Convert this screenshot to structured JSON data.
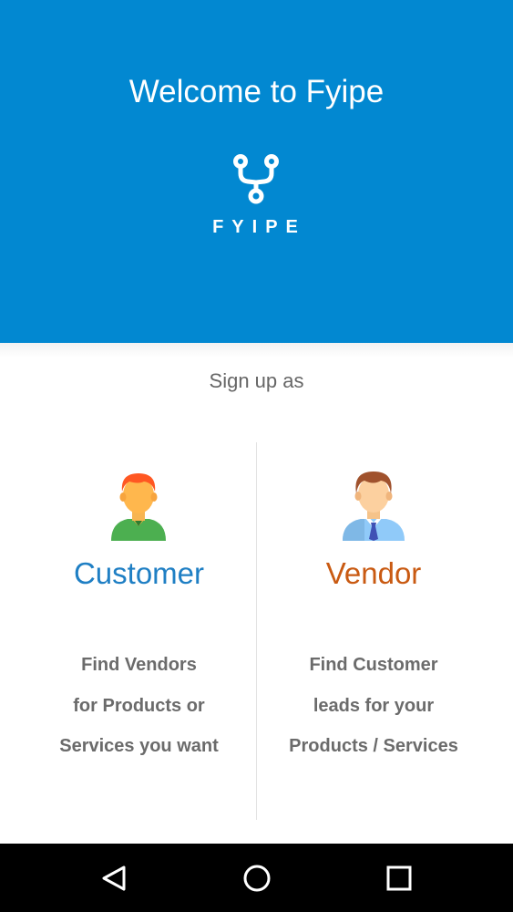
{
  "header": {
    "welcome_title": "Welcome to Fyipe",
    "logo_text": "FYIPE",
    "logo_icon": "fyipe-fork-logo-icon",
    "background_color": "#0288d1"
  },
  "signup": {
    "heading": "Sign up as"
  },
  "options": [
    {
      "title": "Customer",
      "title_color": "#1f7fc4",
      "avatar_icon": "customer-avatar-icon",
      "description_lines": [
        "Find Vendors",
        "for Products or",
        "Services you want"
      ]
    },
    {
      "title": "Vendor",
      "title_color": "#c95a12",
      "avatar_icon": "vendor-avatar-icon",
      "description_lines": [
        "Find Customer",
        "leads for your",
        "Products / Services"
      ]
    }
  ],
  "navbar": {
    "back_icon": "back-triangle-icon",
    "home_icon": "home-circle-icon",
    "recent_icon": "recent-apps-square-icon"
  }
}
